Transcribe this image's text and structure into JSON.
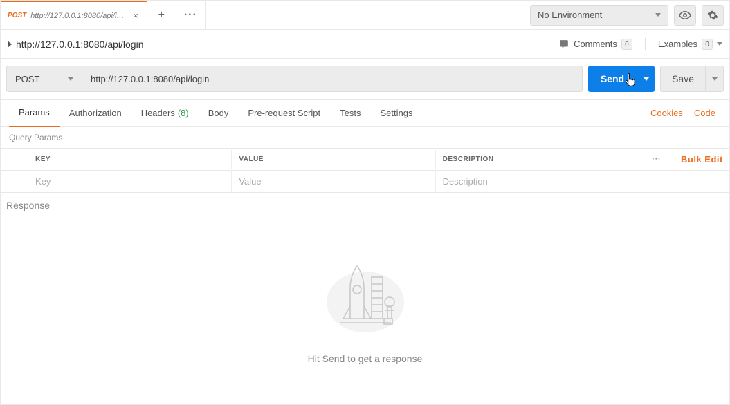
{
  "accent": "#ed6b1f",
  "primary": "#0d7fe9",
  "topbar": {
    "tab": {
      "method": "POST",
      "url": "http://127.0.0.1:8080/api/login"
    },
    "env_label": "No Environment"
  },
  "titlebar": {
    "title": "http://127.0.0.1:8080/api/login",
    "comments_label": "Comments",
    "comments_count": "0",
    "examples_label": "Examples",
    "examples_count": "0"
  },
  "urlrow": {
    "method": "POST",
    "url": "http://127.0.0.1:8080/api/login",
    "send_label": "Send",
    "save_label": "Save"
  },
  "reqtabs": {
    "params": "Params",
    "authorization": "Authorization",
    "headers": "Headers",
    "headers_count": "(8)",
    "body": "Body",
    "prerequest": "Pre-request Script",
    "tests": "Tests",
    "settings": "Settings",
    "cookies": "Cookies",
    "code": "Code"
  },
  "qp": {
    "section_label": "Query Params",
    "col_key": "KEY",
    "col_value": "VALUE",
    "col_desc": "DESCRIPTION",
    "bulk_edit": "Bulk Edit",
    "ph_key": "Key",
    "ph_value": "Value",
    "ph_desc": "Description"
  },
  "response": {
    "label": "Response",
    "empty_message": "Hit Send to get a response"
  }
}
